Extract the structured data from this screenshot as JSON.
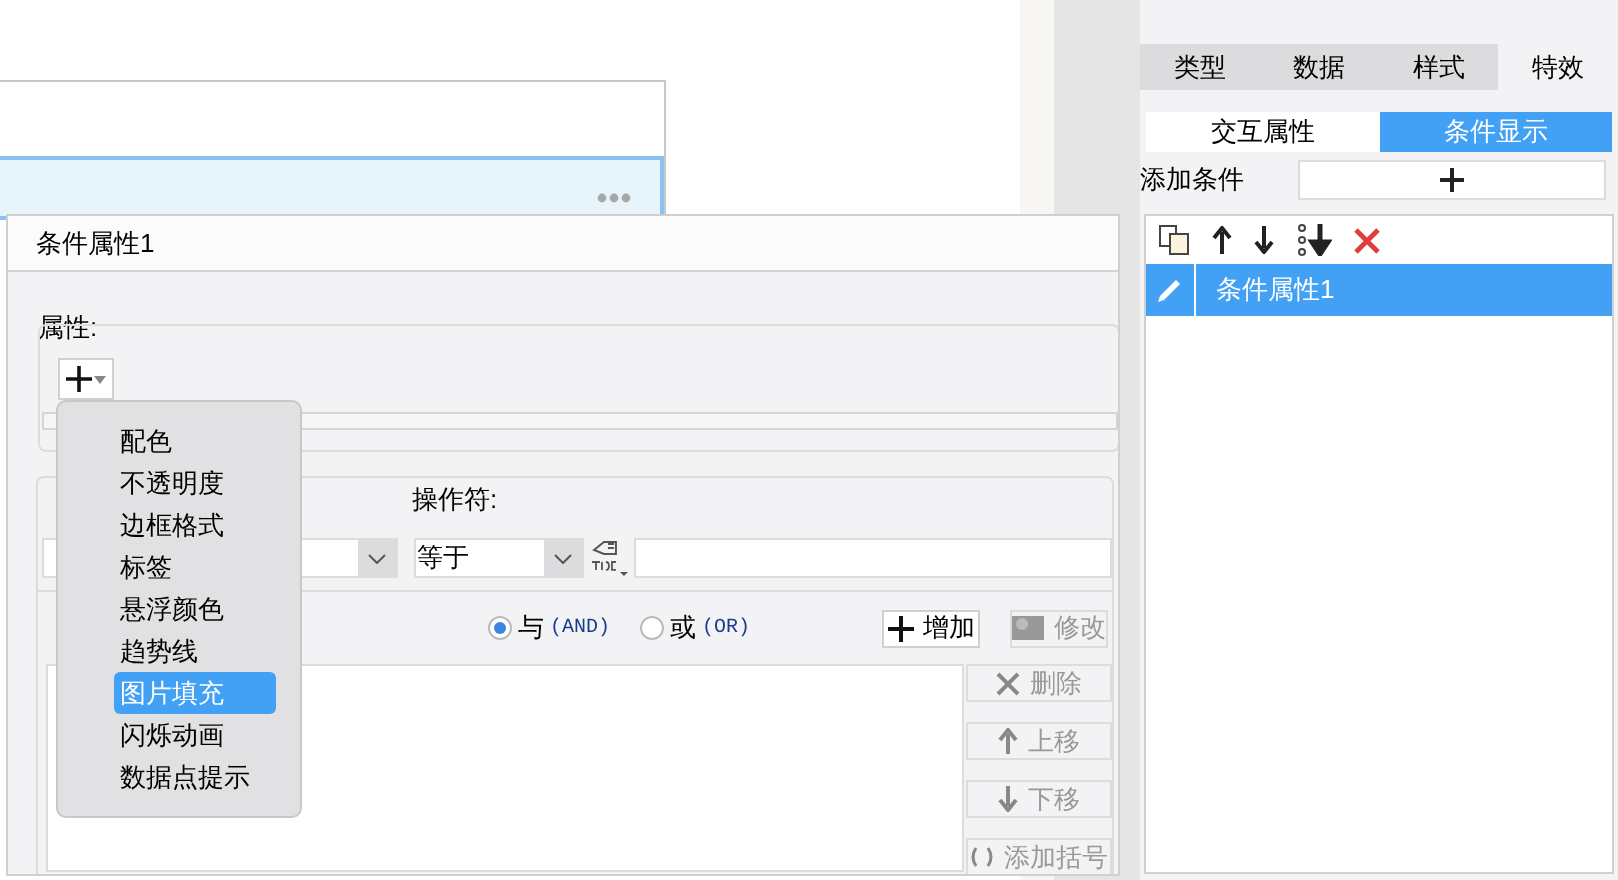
{
  "right_panel": {
    "tabs": [
      {
        "label": "类型",
        "selected": false
      },
      {
        "label": "数据",
        "selected": false
      },
      {
        "label": "样式",
        "selected": false
      },
      {
        "label": "特效",
        "selected": true
      }
    ],
    "subtabs": [
      {
        "label": "交互属性",
        "selected": false
      },
      {
        "label": "条件显示",
        "selected": true
      }
    ],
    "add_condition_label": "添加条件",
    "conditions": [
      {
        "label": "条件属性1",
        "selected": true
      }
    ]
  },
  "dialog": {
    "title": "条件属性1",
    "property_label": "属性:",
    "operator_label": "操作符:",
    "operator_value": "等于",
    "logic": [
      {
        "label": "与",
        "suffix": "(AND)",
        "selected": true
      },
      {
        "label": "或",
        "suffix": "(OR)",
        "selected": false
      }
    ],
    "buttons": [
      {
        "kind": "add",
        "label": "增加",
        "disabled": false
      },
      {
        "kind": "edit",
        "label": "修改",
        "disabled": true
      }
    ],
    "side_buttons": [
      {
        "kind": "delete",
        "label": "删除",
        "disabled": true
      },
      {
        "kind": "up",
        "label": "上移",
        "disabled": true
      },
      {
        "kind": "down",
        "label": "下移",
        "disabled": true
      },
      {
        "kind": "bracket",
        "label": "添加括号",
        "disabled": true
      }
    ]
  },
  "menu": {
    "items": [
      {
        "label": "配色",
        "selected": false
      },
      {
        "label": "不透明度",
        "selected": false
      },
      {
        "label": "边框格式",
        "selected": false
      },
      {
        "label": "标签",
        "selected": false
      },
      {
        "label": "悬浮颜色",
        "selected": false
      },
      {
        "label": "趋势线",
        "selected": false
      },
      {
        "label": "图片填充",
        "selected": true
      },
      {
        "label": "闪烁动画",
        "selected": false
      },
      {
        "label": "数据点提示",
        "selected": false
      }
    ]
  }
}
